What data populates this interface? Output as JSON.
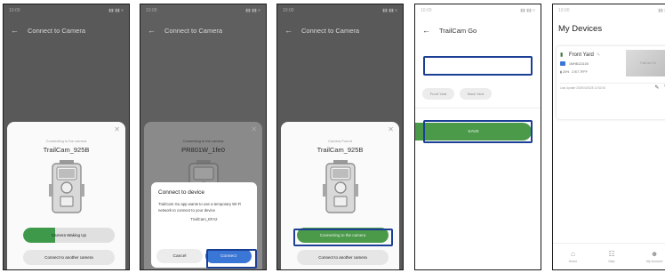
{
  "statusbar": {
    "time": "10:00",
    "icons": "▮▮ ▮▮ ≡"
  },
  "screen1": {
    "title": "Connect to Camera",
    "subtitle": "Connecting to the camera",
    "camera_name": "TrailCam_925B",
    "progress_label": "Camera Waking Up",
    "progress": 0.35,
    "secondary_button": "Connect to another camera"
  },
  "screen2": {
    "title": "Connect to Camera",
    "subtitle": "Connecting to the camera",
    "camera_name": "PR801W_1fe0",
    "dialog": {
      "title": "Connect to device",
      "message": "TrailCam Go app wants to use a temporary Wi-Fi network to connect to your device",
      "network": "TrailCam_EFA2",
      "cancel": "Cancel",
      "connect": "Connect"
    }
  },
  "screen3": {
    "title": "Connect to Camera",
    "subtitle": "Camera Found",
    "camera_name": "TrailCam_925B",
    "primary_button": "Connecting to the camera",
    "secondary_button": "Connect to another camera"
  },
  "screen4": {
    "title": "TrailCam Go",
    "input_value": "",
    "chips": [
      "Front Yard",
      "Back Yard"
    ],
    "save_button": "SAVE"
  },
  "screen5": {
    "title": "My Devices",
    "device": {
      "name": "Front Yard",
      "id": "1MHB121105",
      "battery": "20%",
      "storage": "2.9/7.7FFF",
      "thumb_text": "TrailCam Go",
      "last_update": "Last Update 2025/04/2025 12:52:06"
    },
    "nav": [
      {
        "label": "Home",
        "icon": "home-icon"
      },
      {
        "label": "Map",
        "icon": "map-icon"
      },
      {
        "label": "My Account",
        "icon": "account-icon"
      }
    ]
  },
  "colors": {
    "accent_green": "#4a9a4a",
    "accent_blue": "#3a76d6",
    "highlight_border": "#1c3f96"
  }
}
